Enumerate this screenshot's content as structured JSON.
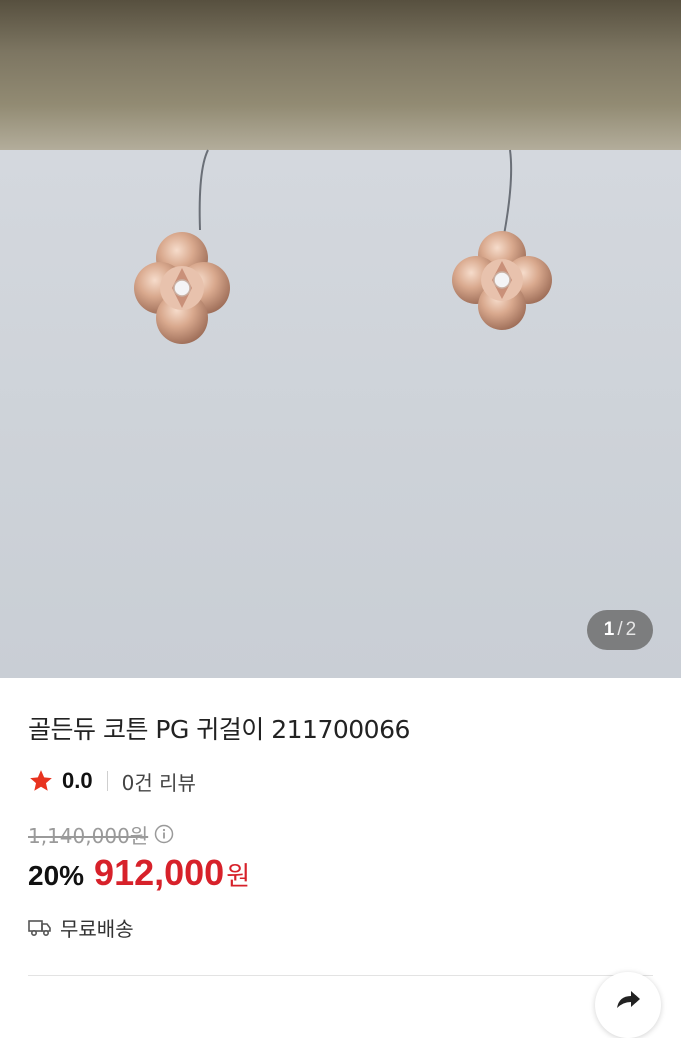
{
  "gallery": {
    "current": "1",
    "separator": "/",
    "total": "2"
  },
  "product": {
    "title": "골든듀 코튼 PG 귀걸이 211700066",
    "rating": "0.0",
    "review_count": "0건 리뷰",
    "original_price": "1,140,000원",
    "discount": "20%",
    "sale_price": "912,000",
    "currency": "원",
    "shipping": "무료배송"
  },
  "colors": {
    "accent_red": "#d7212a",
    "star_red": "#e8331f"
  },
  "icons": {
    "star": "star-icon",
    "info": "info-icon",
    "truck": "truck-icon",
    "share": "share-icon"
  }
}
